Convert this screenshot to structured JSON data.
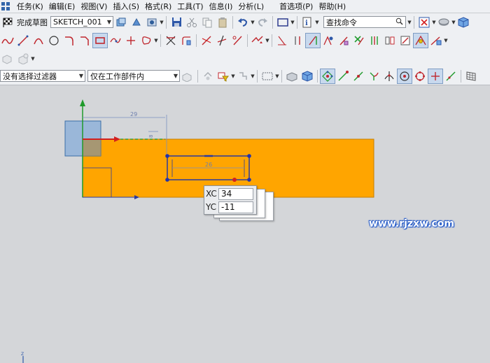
{
  "menubar": {
    "items": [
      "任务(K)",
      "编辑(E)",
      "视图(V)",
      "插入(S)",
      "格式(R)",
      "工具(T)",
      "信息(I)",
      "分析(L)",
      "首选项(P)",
      "帮助(H)"
    ]
  },
  "toolbar1": {
    "finish_sketch_label": "完成草图",
    "sketch_name": "SKETCH_001",
    "search_placeholder": "查找命令"
  },
  "toolbar4": {
    "filter_value": "没有选择过滤器",
    "scope_value": "仅在工作部件内"
  },
  "canvas": {
    "dimension_29": "29",
    "dimension_small": "8",
    "dimension_inner": "26",
    "coord_xc_label": "XC",
    "coord_xc_value": "34",
    "coord_yc_label": "YC",
    "coord_yc_value": "-11",
    "watermark": "www.rjzxw.com",
    "axis_z_label": "Z"
  },
  "colors": {
    "sketch_fill": "#ffa500",
    "sketch_edge": "#2b3a9e",
    "background": "#d4d6d9",
    "axis_x": "#d22020",
    "axis_y": "#1f9a2b",
    "dimension": "#7a8fc0"
  },
  "icons": {
    "toolbar1": [
      "checkered-flag-icon",
      "save-icon",
      "cut-icon",
      "copy-icon",
      "paste-icon",
      "undo-icon",
      "redo-icon",
      "rectangle-select-icon",
      "info-icon",
      "orient-view-icon",
      "render-style-icon",
      "cube-icon"
    ],
    "toolbar2": [
      "profile-icon",
      "line-icon",
      "arc-icon",
      "circle-icon",
      "fillet-icon",
      "chamfer-icon",
      "rectangle-icon",
      "polygon-icon",
      "point-icon",
      "offset-curve-icon",
      "quick-trim-icon",
      "quick-extend-icon",
      "make-corner-icon",
      "derived-line-icon",
      "dimension-icon",
      "constraint-icon",
      "sketch-tools-icon"
    ],
    "toolbar4": [
      "snap-point-icon",
      "endpoint-icon",
      "midpoint-icon",
      "control-point-icon",
      "intersection-icon",
      "arc-center-icon",
      "quadrant-icon",
      "existing-point-icon",
      "point-on-curve-icon",
      "grid-icon"
    ]
  }
}
